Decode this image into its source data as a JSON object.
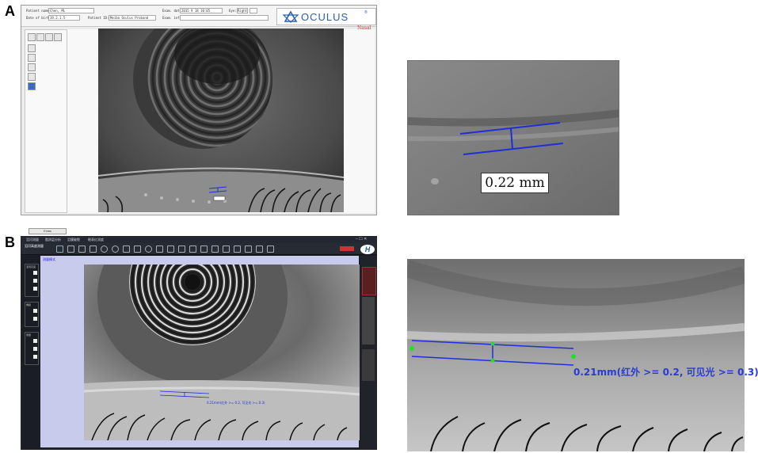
{
  "panels": {
    "a": {
      "letter": "A",
      "software": {
        "logo_text": "OCULUS",
        "logo_mark": "®",
        "orientation": "Nasal",
        "header_fields": [
          {
            "label": "Patient name:",
            "value": "Chen, ML"
          },
          {
            "label": "Date of birth:",
            "value": "19.2.1.5"
          },
          {
            "label": "Patient ID:",
            "value": "Meibo Oculus Proband"
          },
          {
            "label": "Exam. date:",
            "value": "2015 9 18 10:05"
          },
          {
            "label": "Exam. info:",
            "value": ""
          },
          {
            "label": "Eye:",
            "value": "Right"
          }
        ],
        "sidebar_button": "Exlas"
      },
      "zoom_measurement": "0.22 mm"
    },
    "b": {
      "letter": "B",
      "software": {
        "menu_items": [
          "泪河测量",
          "脂质层分析",
          "泪膜破裂",
          "眼表红润度"
        ],
        "tab_label": "泪河高度测量",
        "mode_label": "测量模式",
        "side_groups": [
          "泪河高度",
          "角膜",
          "测量",
          "分析"
        ]
      },
      "overlay_measurement": "0.21mm(红外 >= 0.2, 可见光 >= 0.3)",
      "zoom_measurement": "0.21mm(红外 >= 0.2, 可见光 >= 0.3)"
    }
  },
  "colors": {
    "measure_line": "#1f2fd8",
    "point_marker": "#22e022",
    "nasal_text": "#d43a3a",
    "oculus_blue": "#2b5fae"
  }
}
